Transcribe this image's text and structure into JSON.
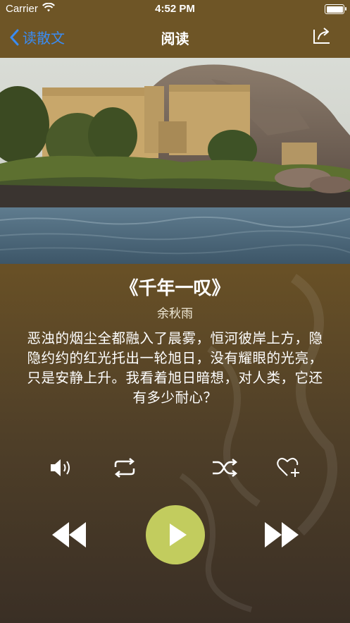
{
  "status_bar": {
    "carrier": "Carrier",
    "time": "4:52 PM"
  },
  "nav": {
    "back_label": "读散文",
    "title": "阅读"
  },
  "poem": {
    "title": "《千年一叹》",
    "author": "余秋雨",
    "text": "恶浊的烟尘全都融入了晨雾，恒河彼岸上方，隐隐约约的红光托出一轮旭日，没有耀眼的光亮，只是安静上升。我看着旭日暗想，对人类，它还有多少耐心？"
  },
  "controls": {
    "volume": "speaker-icon",
    "repeat": "repeat-icon",
    "shuffle": "shuffle-icon",
    "favorite": "heart-plus-icon",
    "rewind": "rewind-icon",
    "play": "play-icon",
    "forward": "fast-forward-icon"
  },
  "colors": {
    "header_bg": "#6e5526",
    "back_blue": "#3a8cf3",
    "play_button": "#c2cc5e"
  }
}
